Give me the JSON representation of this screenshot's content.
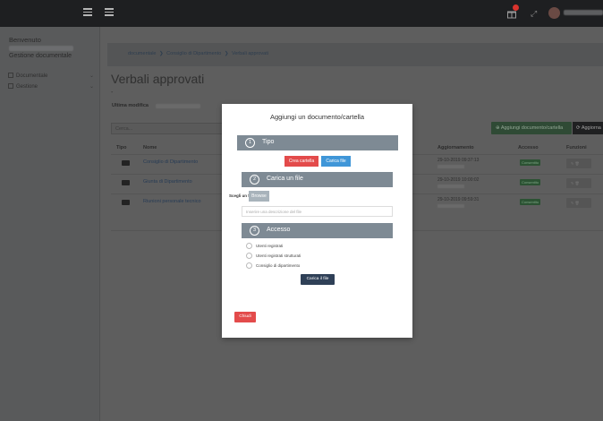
{
  "topbar": {
    "sidebar_toggle_icon": "hamburger-icon",
    "main_toggle_icon": "hamburger-icon",
    "notification_icon": "gift-icon",
    "notification_color": "#d9332d",
    "expand_icon": "expand-icon",
    "expand_glyph": "⤢"
  },
  "sidebar": {
    "welcome": "Benvenuto",
    "area": "Gestione documentale",
    "items": [
      {
        "label": "Documentale",
        "icon": "folder-icon",
        "chevron": "⌄"
      },
      {
        "label": "Gestione",
        "icon": "users-icon",
        "chevron": "⌄"
      }
    ]
  },
  "breadcrumb": {
    "items": [
      "documentale",
      "Consiglio di Dipartimento",
      "Verbali approvati"
    ],
    "separator": "❯"
  },
  "page": {
    "title": "Verbali approvati",
    "dash": "-",
    "last_modified_label": "Ultima modifica"
  },
  "toolbar": {
    "search_placeholder": "Cerca...",
    "add_label": "⊕ Aggiungi documento/cartella",
    "refresh_label": "⟳ Aggiorna",
    "accent_color": "#2f4a35"
  },
  "table": {
    "headers": [
      "Tipo",
      "Nome",
      "Aggiornamento",
      "Accesso",
      "Funzioni"
    ],
    "rows": [
      {
        "name": "Consiglio di Dipartimento",
        "updated": "29-10-2019 09:37:13",
        "access": "Consentito",
        "actions": "✎ 🗑"
      },
      {
        "name": "Giunta di Dipartimento",
        "updated": "29-10-2019 10:00:02",
        "access": "Consentito",
        "actions": "✎ 🗑"
      },
      {
        "name": "Riunioni personale tecnico",
        "updated": "29-10-2019 09:59:31",
        "access": "Consentito",
        "actions": "✎ 🗑"
      }
    ]
  },
  "modal": {
    "title": "Aggiungi un documento/cartella",
    "sections": [
      {
        "num": "1",
        "label": "Tipo"
      },
      {
        "num": "2",
        "label": "Carica un file"
      },
      {
        "num": "3",
        "label": "Accesso"
      }
    ],
    "create_folder_label": "Crea cartella",
    "upload_file_label": "Carica file",
    "choose_file_label": "Scegli un file",
    "browse_label": "Browse",
    "description_placeholder": "Inserire una descrizione del file",
    "access_options": [
      "Utenti registrati",
      "Utenti registrati strutturati",
      "Consiglio di dipartimento"
    ],
    "upload_button_label": "Carica il file",
    "close_label": "Chiudi",
    "colors": {
      "danger": "#e34b4b",
      "info": "#3f96d8",
      "section": "#7e8a94",
      "dark": "#2f4057"
    }
  }
}
